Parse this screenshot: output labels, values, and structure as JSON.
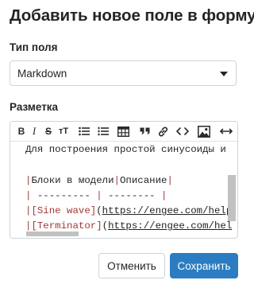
{
  "dialog": {
    "title": "Добавить новое поле в форму",
    "type_label": "Тип поля",
    "type_value": "Markdown",
    "markup_label": "Разметка",
    "cancel_label": "Отменить",
    "save_label": "Сохранить",
    "accent_color": "#2b7cc0"
  },
  "toolbar": {
    "bold": "B",
    "italic": "I",
    "strike": "S",
    "heading": "тT"
  },
  "editor": {
    "line0": "Для построения простой синусоиды и",
    "line2_a": "|",
    "line2_b": "Блоки в модели",
    "line2_c": "|",
    "line2_d": "Описание",
    "line2_e": "|",
    "line3_a": "|",
    "line3_b": " --------- ",
    "line3_c": "|",
    "line3_d": " -------- ",
    "line3_e": "|",
    "line4_a": "|",
    "line4_b": "[Sine wave]",
    "line4_c": "(",
    "line4_d": "https://engee.com/help",
    "line5_a": "|",
    "line5_b": "[Terminator]",
    "line5_c": "(",
    "line5_d": "https://engee.com/hel"
  }
}
